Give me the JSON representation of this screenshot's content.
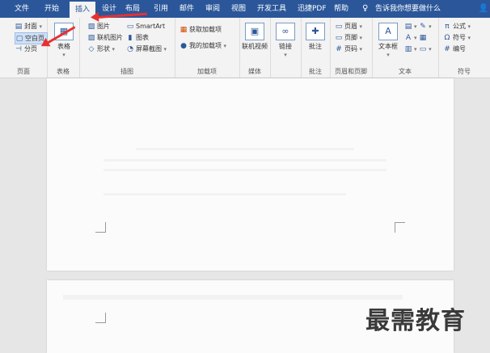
{
  "menubar": {
    "tabs": [
      "文件",
      "开始",
      "插入",
      "设计",
      "布局",
      "引用",
      "邮件",
      "审阅",
      "视图",
      "开发工具",
      "迅捷PDF",
      "帮助"
    ],
    "active_tab": "插入",
    "tell_me": "告诉我你想要做什么",
    "share": "共享"
  },
  "ribbon": {
    "pages": {
      "label": "页面",
      "items": [
        "封面",
        "空白页",
        "分页"
      ]
    },
    "tables": {
      "label": "表格",
      "button": "表格"
    },
    "illustrations": {
      "label": "插图",
      "items": [
        "图片",
        "联机图片",
        "形状",
        "SmartArt",
        "图表",
        "屏幕截图"
      ]
    },
    "addins": {
      "label": "加载项",
      "items": [
        "获取加载项",
        "我的加载项"
      ]
    },
    "media": {
      "label": "媒体",
      "button": "联机视频"
    },
    "links": {
      "label": "",
      "button": "链接"
    },
    "comments": {
      "label": "批注",
      "button": "批注"
    },
    "header_footer": {
      "label": "页眉和页脚",
      "items": [
        "页眉",
        "页脚",
        "页码"
      ]
    },
    "text": {
      "label": "文本",
      "button": "文本框"
    },
    "symbols": {
      "label": "符号",
      "items": [
        "公式",
        "符号",
        "编号"
      ]
    }
  },
  "watermark": "最需教育"
}
